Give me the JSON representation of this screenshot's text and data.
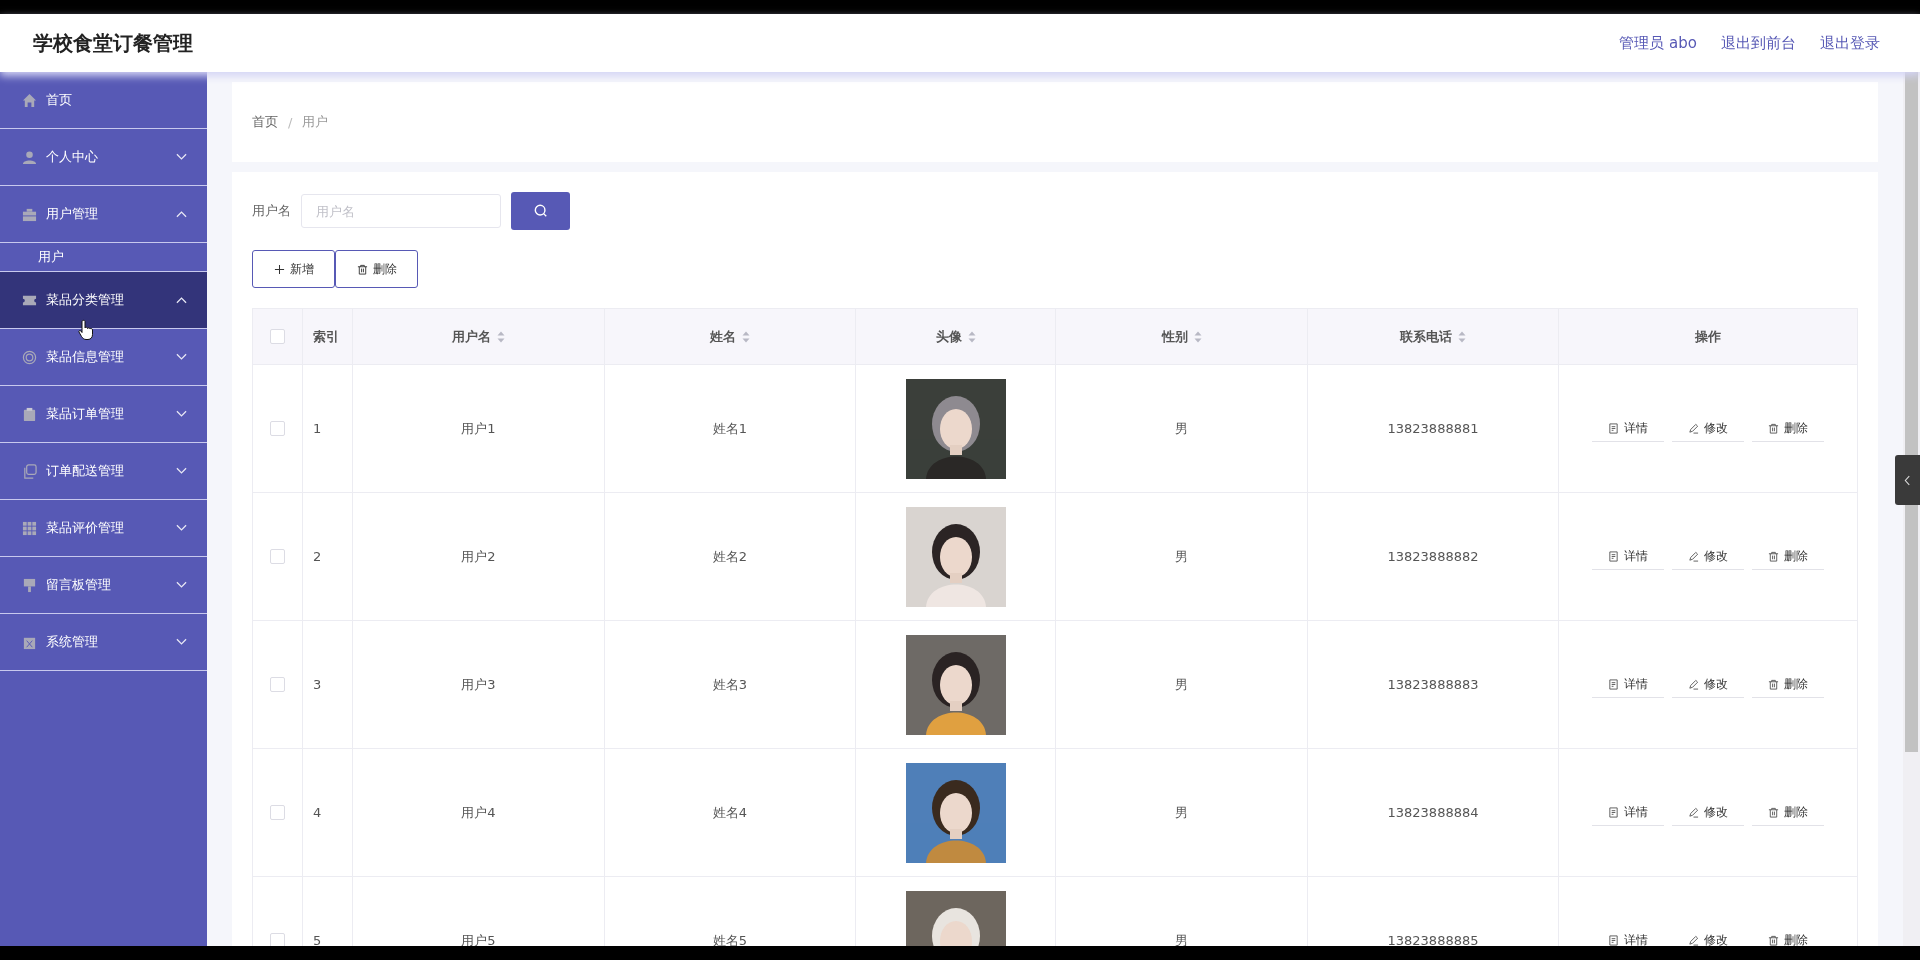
{
  "header": {
    "title": "学校食堂订餐管理",
    "links": [
      "管理员 abo",
      "退出到前台",
      "退出登录"
    ]
  },
  "sidebar": {
    "items": [
      {
        "label": "首页",
        "kind": "link",
        "selected": false
      },
      {
        "label": "个人中心",
        "kind": "menu",
        "selected": false,
        "expanded": false
      },
      {
        "label": "用户管理",
        "kind": "menu",
        "selected": false,
        "expanded": true,
        "children": [
          {
            "label": "用户",
            "selected": false
          }
        ]
      },
      {
        "label": "菜品分类管理",
        "kind": "menu",
        "selected": true,
        "expanded": true
      },
      {
        "label": "菜品信息管理",
        "kind": "menu",
        "selected": false,
        "expanded": false
      },
      {
        "label": "菜品订单管理",
        "kind": "menu",
        "selected": false,
        "expanded": false
      },
      {
        "label": "订单配送管理",
        "kind": "menu",
        "selected": false,
        "expanded": false
      },
      {
        "label": "菜品评价管理",
        "kind": "menu",
        "selected": false,
        "expanded": false
      },
      {
        "label": "留言板管理",
        "kind": "menu",
        "selected": false,
        "expanded": false
      },
      {
        "label": "系统管理",
        "kind": "menu",
        "selected": false,
        "expanded": false
      }
    ]
  },
  "breadcrumb": {
    "items": [
      "首页",
      "用户"
    ],
    "separator": "/"
  },
  "search": {
    "label": "用户名",
    "placeholder": "用户名"
  },
  "toolbar": [
    {
      "label": "新增",
      "kind": "add"
    },
    {
      "label": "删除",
      "kind": "delete"
    }
  ],
  "table": {
    "all_checked": false,
    "columns": [
      {
        "label": "索引",
        "sortable": false
      },
      {
        "label": "用户名",
        "sortable": true
      },
      {
        "label": "姓名",
        "sortable": true
      },
      {
        "label": "头像",
        "sortable": true
      },
      {
        "label": "性别",
        "sortable": true
      },
      {
        "label": "联系电话",
        "sortable": true
      },
      {
        "label": "操作",
        "sortable": false
      }
    ],
    "rows": [
      {
        "checked": false,
        "index": "1",
        "username": "用户1",
        "name": "姓名1",
        "gender": "男",
        "phone": "13823888881",
        "actions": [
          {
            "label": "详情",
            "kind": "detail"
          },
          {
            "label": "修改",
            "kind": "edit"
          },
          {
            "label": "删除",
            "kind": "delete"
          }
        ]
      },
      {
        "checked": false,
        "index": "2",
        "username": "用户2",
        "name": "姓名2",
        "gender": "男",
        "phone": "13823888882",
        "actions": [
          {
            "label": "详情",
            "kind": "detail"
          },
          {
            "label": "修改",
            "kind": "edit"
          },
          {
            "label": "删除",
            "kind": "delete"
          }
        ]
      },
      {
        "checked": false,
        "index": "3",
        "username": "用户3",
        "name": "姓名3",
        "gender": "男",
        "phone": "13823888883",
        "actions": [
          {
            "label": "详情",
            "kind": "detail"
          },
          {
            "label": "修改",
            "kind": "edit"
          },
          {
            "label": "删除",
            "kind": "delete"
          }
        ]
      },
      {
        "checked": false,
        "index": "4",
        "username": "用户4",
        "name": "姓名4",
        "gender": "男",
        "phone": "13823888884",
        "actions": [
          {
            "label": "详情",
            "kind": "detail"
          },
          {
            "label": "修改",
            "kind": "edit"
          },
          {
            "label": "删除",
            "kind": "delete"
          }
        ]
      },
      {
        "checked": false,
        "index": "5",
        "username": "用户5",
        "name": "姓名5",
        "gender": "男",
        "phone": "13823888885",
        "actions": [
          {
            "label": "详情",
            "kind": "detail"
          },
          {
            "label": "修改",
            "kind": "edit"
          },
          {
            "label": "删除",
            "kind": "delete"
          }
        ]
      }
    ]
  }
}
